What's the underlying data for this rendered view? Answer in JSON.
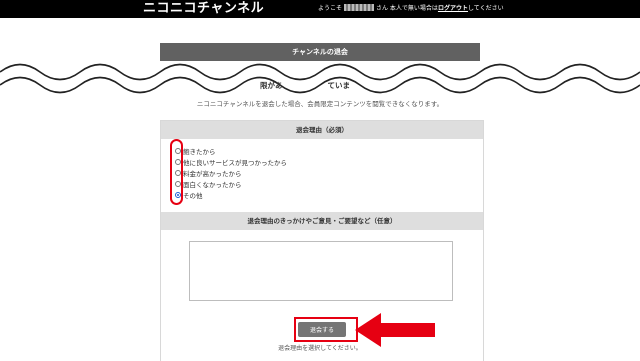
{
  "header": {
    "logo": "ニコニコチャンネル",
    "welcome_prefix": "ようこそ",
    "welcome_mid": "さん 本人で無い場合は",
    "logout_link": "ログアウト",
    "welcome_suffix": "してください"
  },
  "page": {
    "title": "チャンネルの退会",
    "partial_heading": "限があ　　　　　　ていま",
    "notice": "ニコニコチャンネルを退会した場合、会員限定コンテンツを閲覧できなくなります。"
  },
  "form": {
    "reason_header": "退会理由（必須）",
    "reasons": [
      {
        "label": "飽きたから",
        "checked": false
      },
      {
        "label": "他に良いサービスが見つかったから",
        "checked": false
      },
      {
        "label": "料金が高かったから",
        "checked": false
      },
      {
        "label": "面白くなかったから",
        "checked": false
      },
      {
        "label": "その他",
        "checked": true
      }
    ],
    "comment_header": "退会理由のきっかけやご意見・ご要望など（任意）",
    "submit_label": "退会する",
    "hint": "退会理由を選択してください。"
  },
  "colors": {
    "accent_red": "#e60012",
    "header_gray": "#616161",
    "section_gray": "#dedede"
  }
}
